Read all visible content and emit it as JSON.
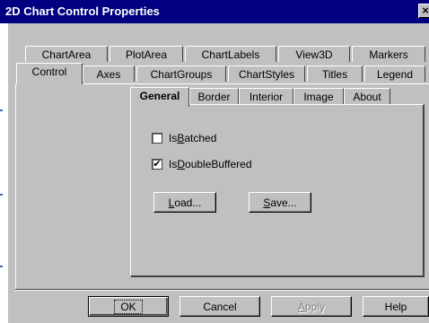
{
  "window": {
    "title": "2D Chart Control Properties",
    "close_glyph": "×"
  },
  "tabs_row_back": [
    {
      "label": "ChartArea"
    },
    {
      "label": "PlotArea"
    },
    {
      "label": "ChartLabels"
    },
    {
      "label": "View3D"
    },
    {
      "label": "Markers"
    }
  ],
  "tabs_row_front": [
    {
      "label": "Control"
    },
    {
      "label": "Axes"
    },
    {
      "label": "ChartGroups"
    },
    {
      "label": "ChartStyles"
    },
    {
      "label": "Titles"
    },
    {
      "label": "Legend"
    }
  ],
  "inner_tabs": [
    {
      "label": "General"
    },
    {
      "label": "Border"
    },
    {
      "label": "Interior"
    },
    {
      "label": "Image"
    },
    {
      "label": "About"
    }
  ],
  "options": {
    "is_batched": {
      "prefix": "Is",
      "mnemonic": "B",
      "rest": "atched",
      "checked": false
    },
    "is_double_buffered": {
      "prefix": "Is",
      "mnemonic": "D",
      "rest": "oubleBuffered",
      "checked": true,
      "check_glyph": "✔"
    }
  },
  "page_buttons": {
    "load": {
      "mnemonic": "L",
      "rest": "oad..."
    },
    "save": {
      "mnemonic": "S",
      "rest": "ave..."
    }
  },
  "footer": {
    "ok": "OK",
    "cancel": "Cancel",
    "apply": {
      "mnemonic": "A",
      "rest": "pply"
    },
    "help": "Help"
  }
}
